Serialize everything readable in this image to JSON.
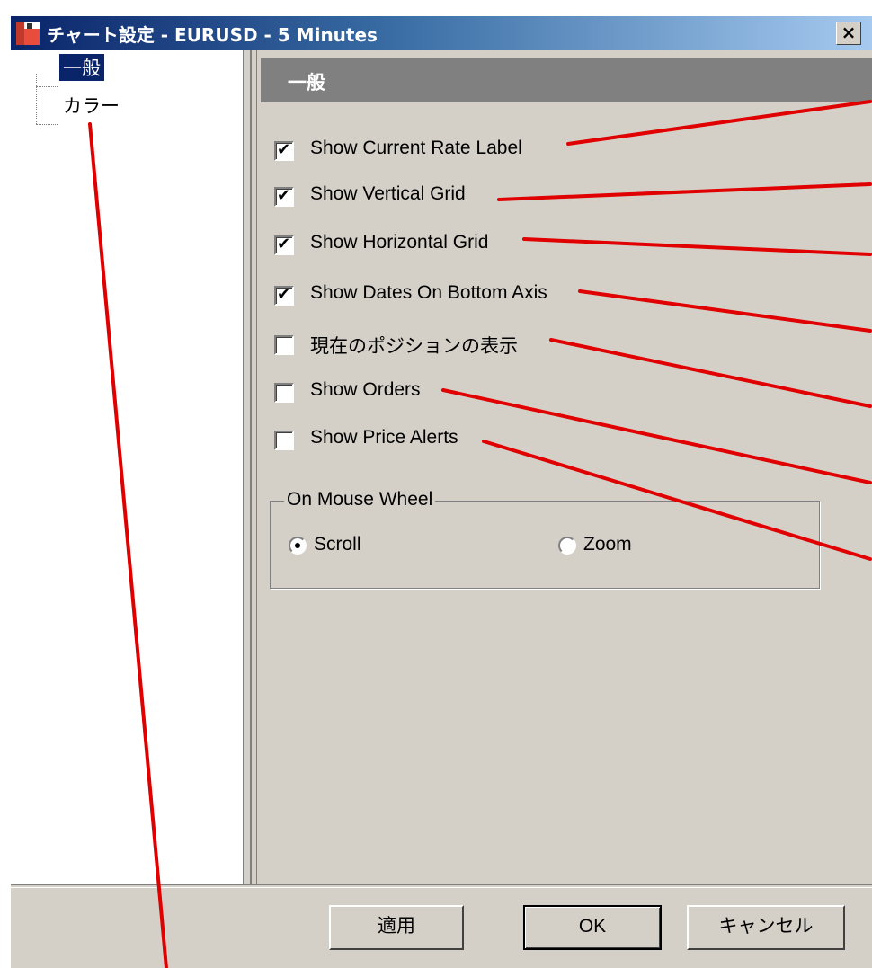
{
  "window": {
    "title": "チャート設定 - EURUSD - 5 Minutes",
    "close_label": "×"
  },
  "tree": {
    "items": [
      {
        "label": "一般",
        "selected": true
      },
      {
        "label": "カラー",
        "selected": false
      }
    ]
  },
  "panel": {
    "title": "一般",
    "checkboxes": [
      {
        "label": "Show Current Rate Label",
        "checked": true
      },
      {
        "label": "Show Vertical Grid",
        "checked": true
      },
      {
        "label": "Show Horizontal Grid",
        "checked": true
      },
      {
        "label": "Show Dates On Bottom Axis",
        "checked": true
      },
      {
        "label": "現在のポジションの表示",
        "checked": false
      },
      {
        "label": "Show Orders",
        "checked": false
      },
      {
        "label": "Show Price Alerts",
        "checked": false
      }
    ],
    "mouse_wheel": {
      "group_label": "On Mouse Wheel",
      "options": [
        {
          "label": "Scroll",
          "selected": true
        },
        {
          "label": "Zoom",
          "selected": false
        }
      ]
    }
  },
  "buttons": {
    "apply": "適用",
    "ok": "OK",
    "cancel": "キャンセル"
  },
  "annotation_color": "#e00000"
}
